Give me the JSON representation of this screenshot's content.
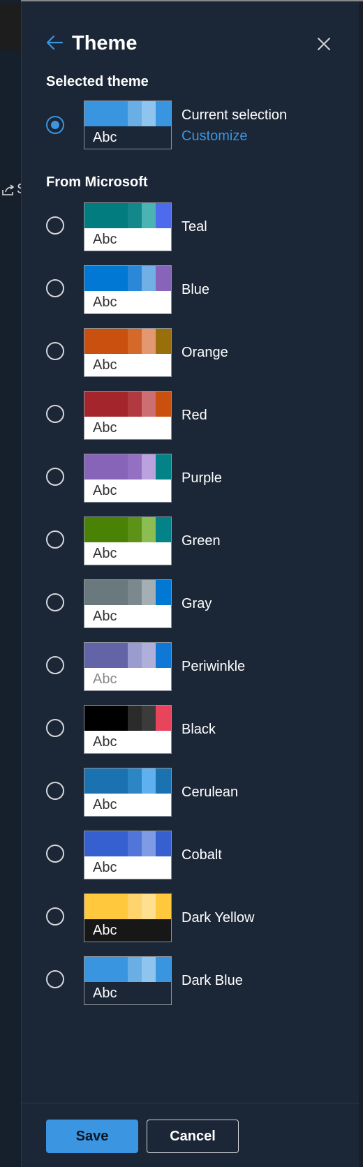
{
  "panel": {
    "title": "Theme",
    "back_icon": "arrow-left-icon",
    "close_icon": "close-icon"
  },
  "background": {
    "share_label": "S"
  },
  "selected_section": {
    "label": "Selected theme",
    "current": {
      "name": "Current selection",
      "link": "Customize",
      "sample": "Abc",
      "selected": true,
      "colors": [
        "#3a95e0",
        "#6aaee6",
        "#8ec4ee",
        "#3a95e0"
      ],
      "bottom_bg": "#1b2636",
      "bottom_fg": "#ffffff"
    }
  },
  "microsoft_section": {
    "label": "From Microsoft",
    "themes": [
      {
        "name": "Teal",
        "sample": "Abc",
        "colors": [
          "#037c80",
          "#12888a",
          "#4cb3b5",
          "#4f6bed"
        ],
        "bottom_bg": "#ffffff",
        "bottom_fg": "#323130"
      },
      {
        "name": "Blue",
        "sample": "Abc",
        "colors": [
          "#0078d4",
          "#2b88d8",
          "#71afe5",
          "#8764b8"
        ],
        "bottom_bg": "#ffffff",
        "bottom_fg": "#323130"
      },
      {
        "name": "Orange",
        "sample": "Abc",
        "colors": [
          "#ca5010",
          "#d5692a",
          "#e39872",
          "#986f0b"
        ],
        "bottom_bg": "#ffffff",
        "bottom_fg": "#323130"
      },
      {
        "name": "Red",
        "sample": "Abc",
        "colors": [
          "#a4262c",
          "#b13a40",
          "#cc6e72",
          "#ca5010"
        ],
        "bottom_bg": "#ffffff",
        "bottom_fg": "#323130"
      },
      {
        "name": "Purple",
        "sample": "Abc",
        "colors": [
          "#8764b8",
          "#9370c2",
          "#b9a2dd",
          "#038387"
        ],
        "bottom_bg": "#ffffff",
        "bottom_fg": "#323130"
      },
      {
        "name": "Green",
        "sample": "Abc",
        "colors": [
          "#498205",
          "#5c9218",
          "#8cbd52",
          "#038387"
        ],
        "bottom_bg": "#ffffff",
        "bottom_fg": "#323130"
      },
      {
        "name": "Gray",
        "sample": "Abc",
        "colors": [
          "#69797e",
          "#7b898e",
          "#a3afb2",
          "#0078d4"
        ],
        "bottom_bg": "#ffffff",
        "bottom_fg": "#323130"
      },
      {
        "name": "Periwinkle",
        "sample": "Abc",
        "colors": [
          "#6264a7",
          "#9a9ccf",
          "#aeb0da",
          "#0f78d6"
        ],
        "bottom_bg": "#ffffff",
        "bottom_fg": "#8a8886"
      },
      {
        "name": "Black",
        "sample": "Abc",
        "colors": [
          "#000000",
          "#2b2b2b",
          "#3b3b3b",
          "#e8445c"
        ],
        "bottom_bg": "#ffffff",
        "bottom_fg": "#323130"
      },
      {
        "name": "Cerulean",
        "sample": "Abc",
        "colors": [
          "#1a73b0",
          "#2c86c4",
          "#5eb1ee",
          "#1a73b0"
        ],
        "bottom_bg": "#ffffff",
        "bottom_fg": "#323130"
      },
      {
        "name": "Cobalt",
        "sample": "Abc",
        "colors": [
          "#3660d0",
          "#5175d8",
          "#7f9be5",
          "#3660d0"
        ],
        "bottom_bg": "#ffffff",
        "bottom_fg": "#323130"
      },
      {
        "name": "Dark Yellow",
        "sample": "Abc",
        "colors": [
          "#ffc83d",
          "#ffd46c",
          "#ffdf90",
          "#ffc83d"
        ],
        "bottom_bg": "#171717",
        "bottom_fg": "#ffffff"
      },
      {
        "name": "Dark Blue",
        "sample": "Abc",
        "colors": [
          "#3a95e0",
          "#6aaee6",
          "#8ec4ee",
          "#3a95e0"
        ],
        "bottom_bg": "#1b2636",
        "bottom_fg": "#ffffff"
      }
    ]
  },
  "footer": {
    "save_label": "Save",
    "cancel_label": "Cancel"
  },
  "colors": {
    "accent": "#3b95e0",
    "panel_bg": "#1b2636"
  }
}
